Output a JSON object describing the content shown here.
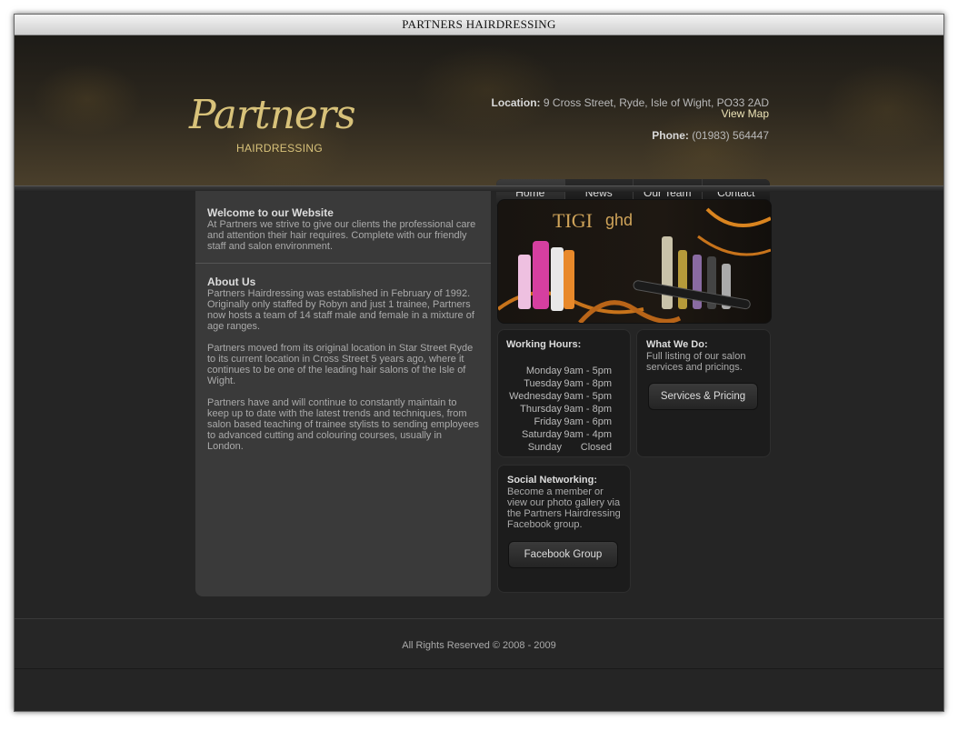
{
  "window": {
    "title": "PARTNERS HAIRDRESSING"
  },
  "logo": {
    "script": "Partners",
    "sub": "HAIRDRESSING"
  },
  "header": {
    "location_label": "Location:",
    "location_value": "9 Cross Street, Ryde, Isle of Wight, PO33 2AD",
    "map_link": "View Map",
    "phone_label": "Phone:",
    "phone_value": "(01983) 564447"
  },
  "nav": [
    "Home",
    "News",
    "Our Team",
    "Contact"
  ],
  "welcome": {
    "title": "Welcome to our Website",
    "text": "At Partners we strive to give our clients the professional care and attention their hair requires. Complete with our friendly staff and salon environment."
  },
  "about": {
    "title": "About Us",
    "p1": "Partners Hairdressing was established in February of 1992. Originally only staffed by Robyn and just 1 trainee, Partners now hosts a team of 14 staff male and female in a mixture of age ranges.",
    "p2": "Partners moved from its original location in Star Street Ryde to its current location in Cross Street 5 years ago, where it continues to be one of the leading hair salons of the Isle of Wight.",
    "p3": "Partners have and will continue to constantly maintain to keep up to date with the latest trends and techniques, from salon based teaching of trainee stylists to sending employees to advanced cutting and colouring courses, usually in London."
  },
  "banner": {
    "brand_text": "TIGI",
    "brand_text2": "ghd"
  },
  "hours": {
    "title": "Working Hours:",
    "rows": [
      {
        "day": "Monday",
        "time": "9am - 5pm"
      },
      {
        "day": "Tuesday",
        "time": "9am - 8pm"
      },
      {
        "day": "Wednesday",
        "time": "9am - 5pm"
      },
      {
        "day": "Thursday",
        "time": "9am - 8pm"
      },
      {
        "day": "Friday",
        "time": "9am - 6pm"
      },
      {
        "day": "Saturday",
        "time": "9am - 4pm"
      },
      {
        "day": "Sunday",
        "time": "Closed"
      }
    ]
  },
  "whatwedo": {
    "title": "What We Do:",
    "text": "Full listing of our salon services and pricings.",
    "button": "Services & Pricing"
  },
  "social": {
    "title": "Social Networking:",
    "text": "Become a member or view our photo gallery via the Partners Hairdressing Facebook group.",
    "button": "Facebook Group"
  },
  "footer": {
    "text": "All Rights Reserved © 2008 - 2009"
  },
  "colors": {
    "gold": "#d8c27a",
    "bg": "#252525",
    "panel": "#3a3a3a"
  }
}
